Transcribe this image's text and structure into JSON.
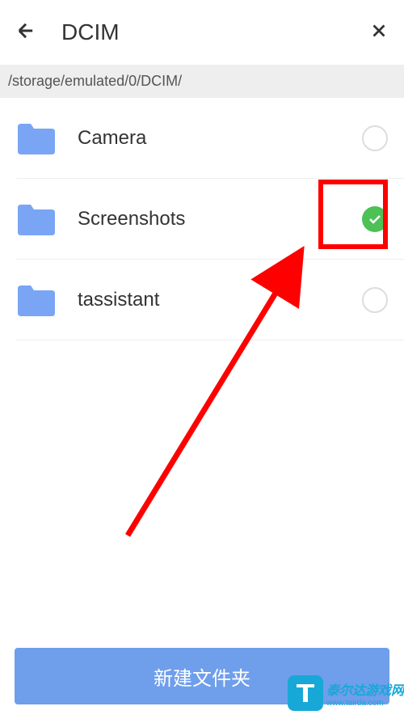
{
  "header": {
    "title": "DCIM"
  },
  "path": "/storage/emulated/0/DCIM/",
  "items": [
    {
      "label": "Camera",
      "selected": false
    },
    {
      "label": "Screenshots",
      "selected": true
    },
    {
      "label": "tassistant",
      "selected": false
    }
  ],
  "button": {
    "create_folder": "新建文件夹"
  },
  "watermark": {
    "line1": "泰尔达游戏网",
    "line2": "www.tairda.com"
  }
}
